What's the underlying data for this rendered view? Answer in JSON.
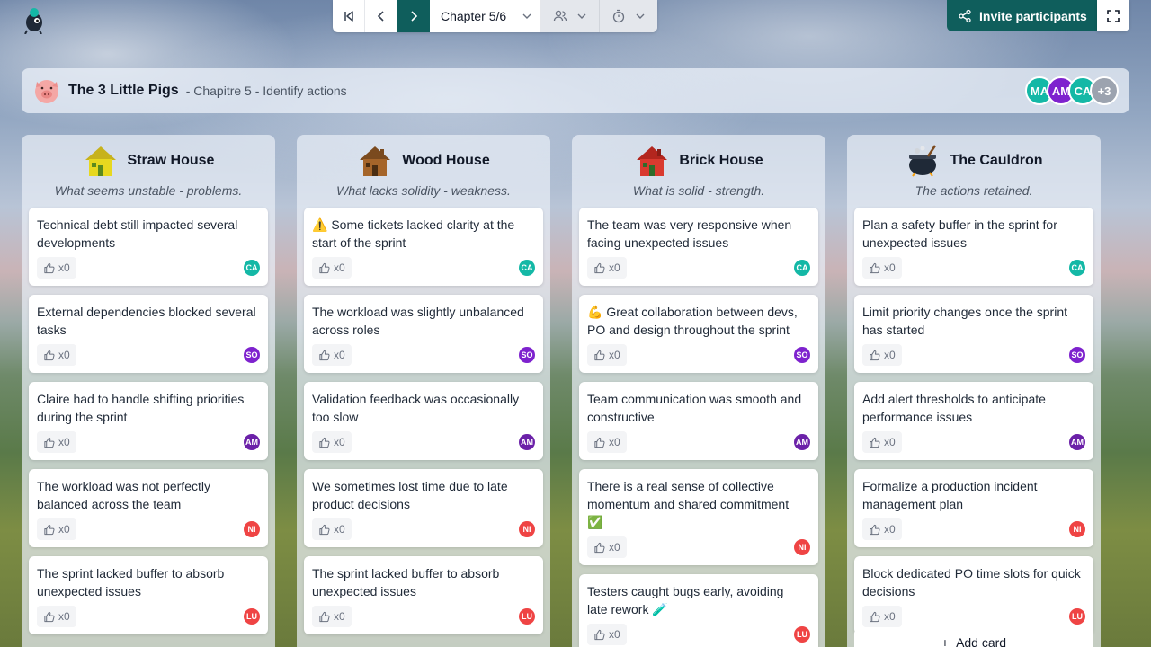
{
  "toolbar": {
    "chapter_label": "Chapter 5/6"
  },
  "invite": {
    "label": "Invite participants"
  },
  "header": {
    "title": "The 3 Little Pigs",
    "subtitle": "- Chapitre 5 - Identify actions",
    "avatars": [
      {
        "initials": "MA",
        "color": "#14b8a6"
      },
      {
        "initials": "AM",
        "color": "#7e22ce"
      },
      {
        "initials": "CA",
        "color": "#14b8a6"
      },
      {
        "initials": "+3",
        "color": "#9ca3af"
      }
    ]
  },
  "colors": {
    "accent": "#0f5e5c",
    "CA": "#14b8a6",
    "SO": "#7e22ce",
    "AM": "#6b21a8",
    "NI": "#ef4444",
    "LU": "#ef4444"
  },
  "columns": [
    {
      "title": "Straw House",
      "subtitle": "What seems unstable - problems.",
      "cards": [
        {
          "text": "Technical debt still impacted several developments",
          "likes": "x0",
          "author": "CA"
        },
        {
          "text": "External dependencies blocked several tasks",
          "likes": "x0",
          "author": "SO"
        },
        {
          "text": "Claire had to handle shifting priorities during the sprint",
          "likes": "x0",
          "author": "AM"
        },
        {
          "text": "The workload was not perfectly balanced across the team",
          "likes": "x0",
          "author": "NI"
        },
        {
          "text": "The sprint lacked buffer to absorb unexpected issues",
          "likes": "x0",
          "author": "LU"
        }
      ]
    },
    {
      "title": "Wood House",
      "subtitle": "What lacks solidity - weakness.",
      "cards": [
        {
          "text": "⚠️ Some tickets lacked clarity at the start of the sprint",
          "likes": "x0",
          "author": "CA"
        },
        {
          "text": "The workload was slightly unbalanced across roles",
          "likes": "x0",
          "author": "SO"
        },
        {
          "text": "Validation feedback was occasionally too slow",
          "likes": "x0",
          "author": "AM"
        },
        {
          "text": "We sometimes lost time due to late product decisions",
          "likes": "x0",
          "author": "NI"
        },
        {
          "text": "The sprint lacked buffer to absorb unexpected issues",
          "likes": "x0",
          "author": "LU"
        }
      ]
    },
    {
      "title": "Brick House",
      "subtitle": "What is solid - strength.",
      "cards": [
        {
          "text": "The team was very responsive when facing unexpected issues",
          "likes": "x0",
          "author": "CA"
        },
        {
          "text": "💪 Great collaboration between devs, PO and design throughout the sprint",
          "likes": "x0",
          "author": "SO"
        },
        {
          "text": "Team communication was smooth and constructive",
          "likes": "x0",
          "author": "AM"
        },
        {
          "text": "There is a real sense of collective momentum and shared commitment ✅",
          "likes": "x0",
          "author": "NI"
        },
        {
          "text": "Testers caught bugs early, avoiding late rework 🧪",
          "likes": "x0",
          "author": "LU"
        }
      ]
    },
    {
      "title": "The Cauldron",
      "subtitle": "The actions retained.",
      "cards": [
        {
          "text": "Plan a safety buffer in the sprint for unexpected issues",
          "likes": "x0",
          "author": "CA"
        },
        {
          "text": "Limit priority changes once the sprint has started",
          "likes": "x0",
          "author": "SO"
        },
        {
          "text": "Add alert thresholds to anticipate performance issues",
          "likes": "x0",
          "author": "AM"
        },
        {
          "text": "Formalize a production incident management plan",
          "likes": "x0",
          "author": "NI"
        },
        {
          "text": "Block dedicated PO time slots for quick decisions",
          "likes": "x0",
          "author": "LU"
        }
      ],
      "add_card": "Add card"
    }
  ]
}
